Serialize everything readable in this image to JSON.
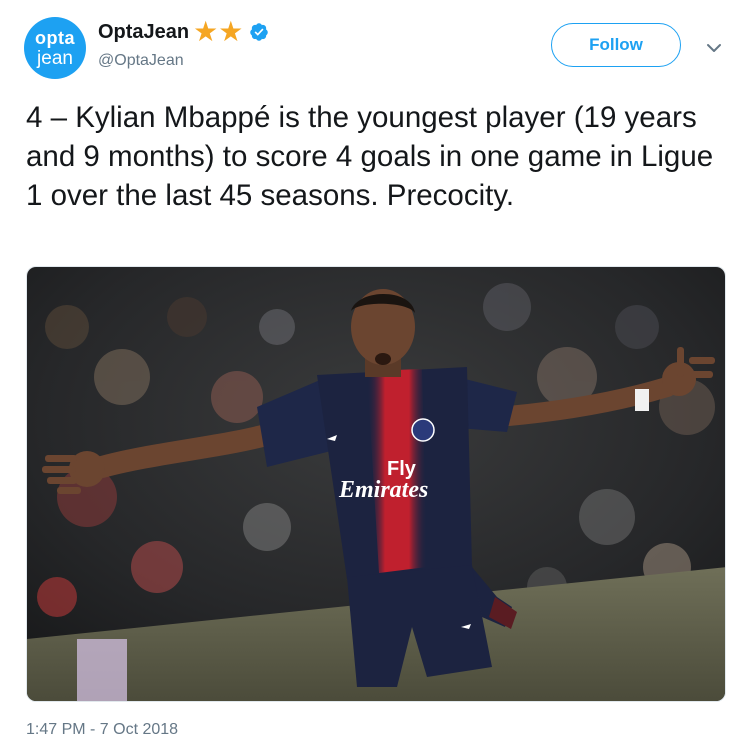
{
  "account": {
    "avatar_line1": "opta",
    "avatar_line2": "jean",
    "display_name": "OptaJean",
    "badges": [
      "star-icon",
      "star-icon",
      "verified-badge-icon"
    ],
    "handle": "@OptaJean"
  },
  "actions": {
    "follow_label": "Follow",
    "menu_icon": "chevron-down-icon"
  },
  "tweet": {
    "text": "4 – Kylian Mbappé is the youngest player (19 years and 9 months) to score 4 goals in one game in Ligue 1 over the last 45 seasons. Precocity.",
    "timestamp": "1:47 PM - 7 Oct 2018"
  },
  "media": {
    "shirt_sponsor_line1": "Fly",
    "shirt_sponsor_line2": "Emirates"
  },
  "colors": {
    "brand_blue": "#1da1f2",
    "star_gold": "#f5a623",
    "muted_text": "#657786"
  }
}
